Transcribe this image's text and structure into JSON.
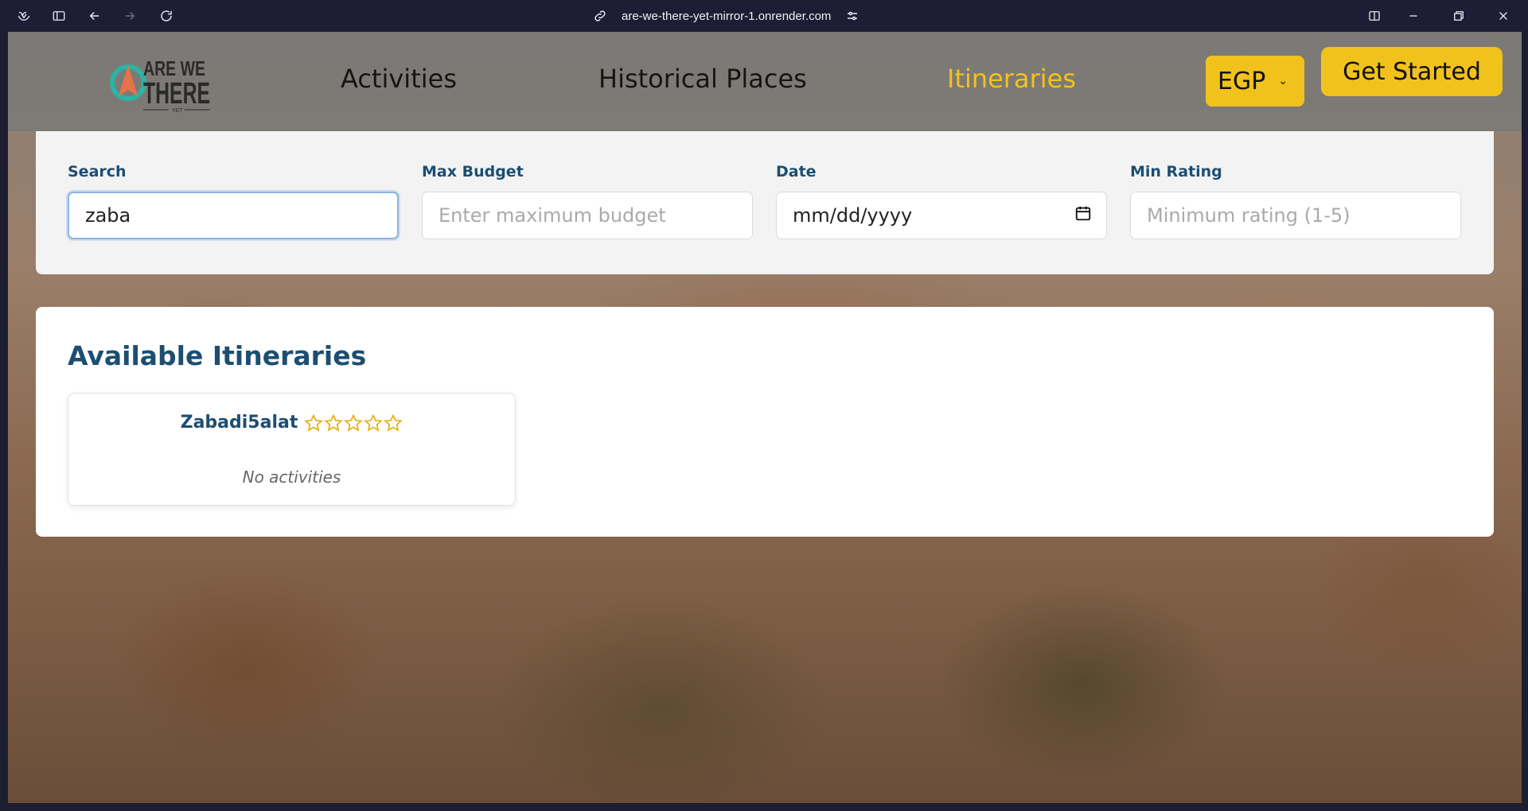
{
  "browser": {
    "url": "are-we-there-yet-mirror-1.onrender.com"
  },
  "logo": {
    "line1": "ARE WE",
    "line2": "THERE",
    "line3": "YET"
  },
  "nav": {
    "links": [
      "Activities",
      "Historical Places",
      "Itineraries"
    ],
    "active": "Itineraries",
    "currency": "EGP",
    "get_started": "Get Started"
  },
  "filters": {
    "search": {
      "label": "Search",
      "value": "zaba"
    },
    "budget": {
      "label": "Max Budget",
      "placeholder": "Enter maximum budget"
    },
    "date": {
      "label": "Date",
      "placeholder": "mm/dd/yyyy"
    },
    "rating": {
      "label": "Min Rating",
      "placeholder": "Minimum rating (1-5)"
    }
  },
  "results": {
    "title": "Available Itineraries",
    "items": [
      {
        "name": "Zabadi5alat",
        "rating": 0,
        "max_rating": 5,
        "activities_text": "No activities"
      }
    ]
  },
  "colors": {
    "accent": "#f1c21b",
    "heading": "#1c4e72"
  }
}
